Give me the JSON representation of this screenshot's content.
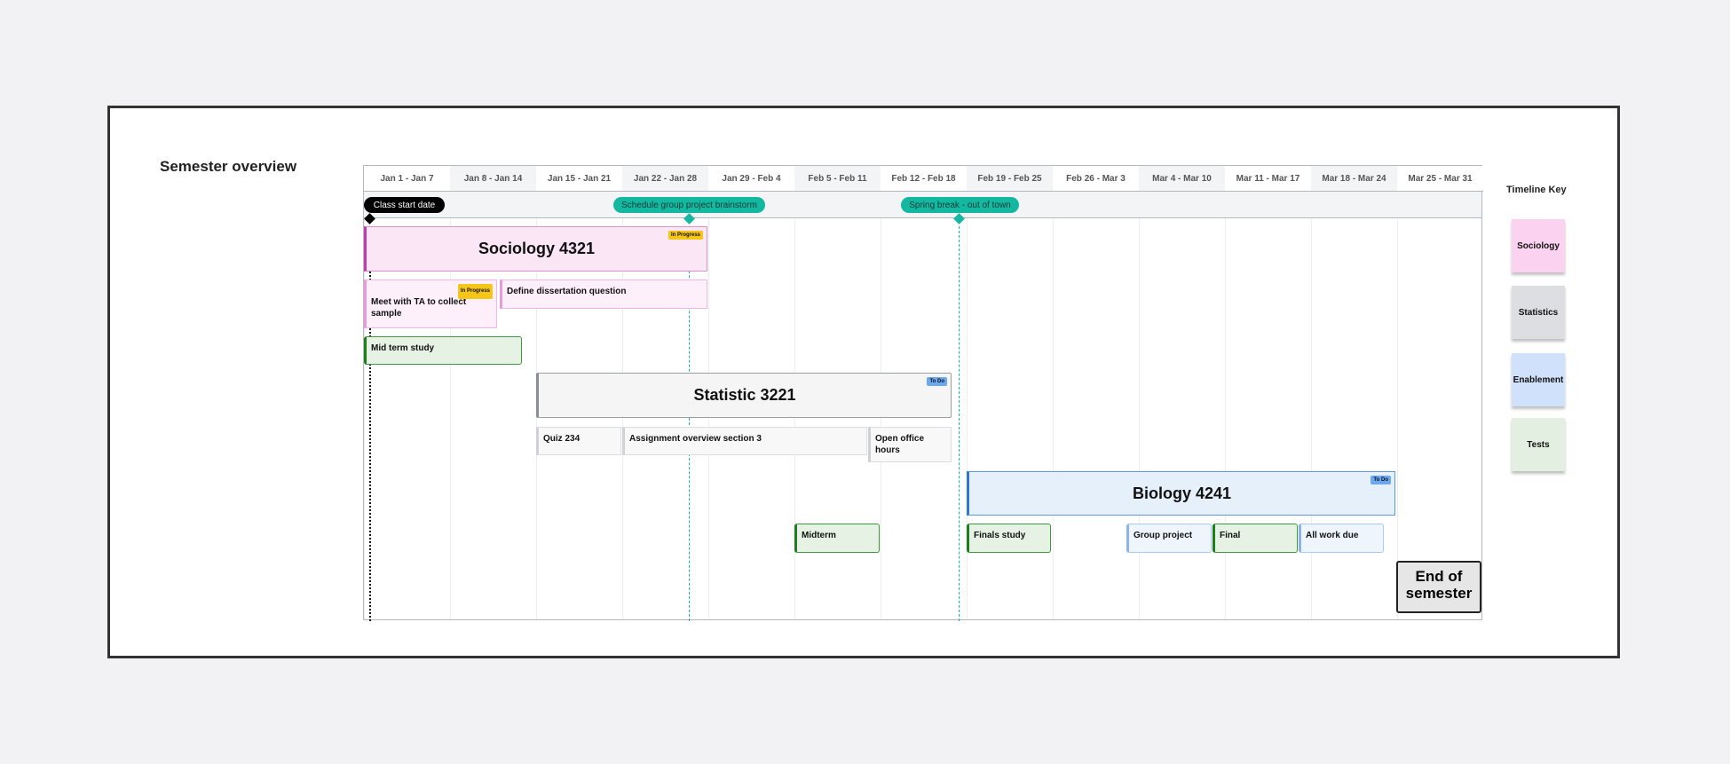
{
  "page_title": "Semester overview",
  "columns": [
    "Jan 1 - Jan 7",
    "Jan 8 - Jan 14",
    "Jan 15 - Jan 21",
    "Jan 22 - Jan 28",
    "Jan 29 - Feb 4",
    "Feb 5 - Feb 11",
    "Feb 12 - Feb 18",
    "Feb 19 - Feb 25",
    "Feb 26 - Mar 3",
    "Mar 4 - Mar 10",
    "Mar 11 - Mar 17",
    "Mar 18 - Mar 24",
    "Mar 25 - Mar 31"
  ],
  "milestones": [
    {
      "label": "Class start date",
      "color": "#000000"
    },
    {
      "label": "Schedule group project brainstorm",
      "color": "#14b8a0"
    },
    {
      "label": "Spring break - out of town",
      "color": "#14b8a0"
    }
  ],
  "sociology": {
    "title": "Sociology 4321",
    "status": "In Progress",
    "tasks": [
      {
        "label": "Meet with TA to collect sample",
        "status": "In Progress"
      },
      {
        "label": "Define dissertation question"
      }
    ],
    "midterm": "Mid term study"
  },
  "statistics": {
    "title": "Statistic 3221",
    "status": "To Do",
    "tasks": [
      "Quiz 234",
      "Assignment overview section 3",
      "Open office hours"
    ],
    "midterm": "Midterm"
  },
  "biology": {
    "title": "Biology 4241",
    "status": "To Do",
    "tasks": [
      "Finals study",
      "Group project",
      "Final",
      "All work due"
    ]
  },
  "end_marker": "End of semester",
  "key": {
    "title": "Timeline Key",
    "items": [
      {
        "label": "Sociology",
        "color": "#fbd3f0"
      },
      {
        "label": "Statistics",
        "color": "#dcdee2"
      },
      {
        "label": "Enablement",
        "color": "#cfe1fb"
      },
      {
        "label": "Tests",
        "color": "#e3efe1"
      }
    ]
  },
  "colors": {
    "in_progress": "#f5c518",
    "to_do": "#6aa8f0",
    "milestone": "#14b8a0"
  }
}
